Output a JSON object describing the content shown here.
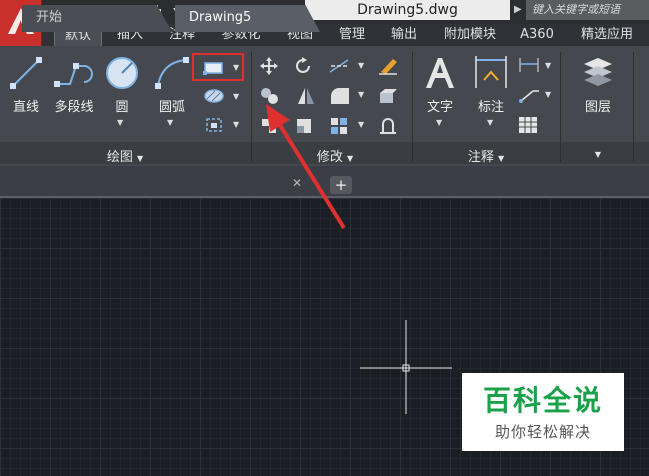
{
  "title_bar": {
    "document_title": "Drawing5.dwg",
    "search_placeholder": "键入关键字或短语"
  },
  "ribbon_tabs": [
    {
      "label": "默认",
      "active": true
    },
    {
      "label": "插入"
    },
    {
      "label": "注释"
    },
    {
      "label": "参数化"
    },
    {
      "label": "视图"
    },
    {
      "label": "管理"
    },
    {
      "label": "输出"
    },
    {
      "label": "附加模块"
    },
    {
      "label": "A360"
    },
    {
      "label": "精选应用"
    }
  ],
  "draw_panel": {
    "title": "绘图",
    "tools": [
      {
        "label": "直线"
      },
      {
        "label": "多段线"
      },
      {
        "label": "圆"
      },
      {
        "label": "圆弧"
      }
    ]
  },
  "modify_panel": {
    "title": "修改"
  },
  "annotation_panel": {
    "title": "注释",
    "tools": [
      {
        "label": "文字"
      },
      {
        "label": "标注"
      }
    ]
  },
  "layers_panel": {
    "tools": [
      {
        "label": "图层"
      }
    ]
  },
  "file_tabs": [
    {
      "label": "开始"
    },
    {
      "label": "Drawing5",
      "active": true
    }
  ],
  "highlight_color": "#e03030",
  "watermark": {
    "title": "百科全说",
    "subtitle": "助你轻松解决"
  }
}
